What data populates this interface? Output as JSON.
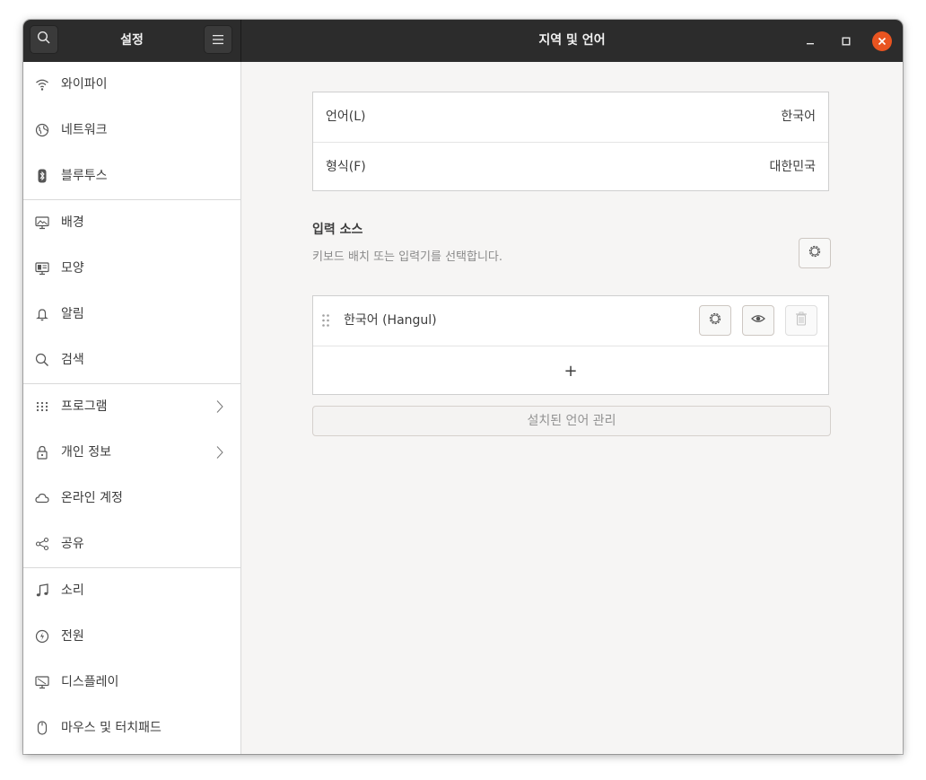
{
  "header": {
    "sidebar_title": "설정",
    "title": "지역 및 언어",
    "search_icon": "search-icon",
    "menu_icon": "hamburger-menu-icon",
    "controls": [
      "minimize-icon",
      "maximize-icon",
      "close-icon"
    ],
    "close_color": "#e95420"
  },
  "sidebar": {
    "items": [
      {
        "label": "와이파이",
        "icon": "wifi-icon"
      },
      {
        "label": "네트워크",
        "icon": "network-globe-icon"
      },
      {
        "label": "블루투스",
        "icon": "bluetooth-icon"
      },
      {
        "label": "배경",
        "icon": "background-monitor-icon"
      },
      {
        "label": "모양",
        "icon": "appearance-icon"
      },
      {
        "label": "알림",
        "icon": "bell-icon"
      },
      {
        "label": "검색",
        "icon": "search-icon"
      },
      {
        "label": "프로그램",
        "icon": "apps-grid-icon"
      },
      {
        "label": "개인 정보",
        "icon": "lock-icon"
      },
      {
        "label": "온라인 계정",
        "icon": "cloud-icon"
      },
      {
        "label": "공유",
        "icon": "share-icon"
      },
      {
        "label": "소리",
        "icon": "music-note-icon"
      },
      {
        "label": "전원",
        "icon": "power-icon"
      },
      {
        "label": "디스플레이",
        "icon": "display-icon"
      },
      {
        "label": "마우스 및 터치패드",
        "icon": "mouse-icon"
      }
    ]
  },
  "region": {
    "language_label": "언어(L)",
    "language_value": "한국어",
    "formats_label": "형식(F)",
    "formats_value": "대한민국"
  },
  "input_sources": {
    "title": "입력 소스",
    "description": "키보드 배치 또는 입력기를 선택합니다.",
    "options_icon": "gear-icon",
    "sources": [
      {
        "name": "한국어 (Hangul)",
        "icons": [
          "gear-icon",
          "eye-icon",
          "trash-icon"
        ]
      }
    ],
    "add_label": "+"
  },
  "manage_languages_label": "설치된 언어 관리"
}
